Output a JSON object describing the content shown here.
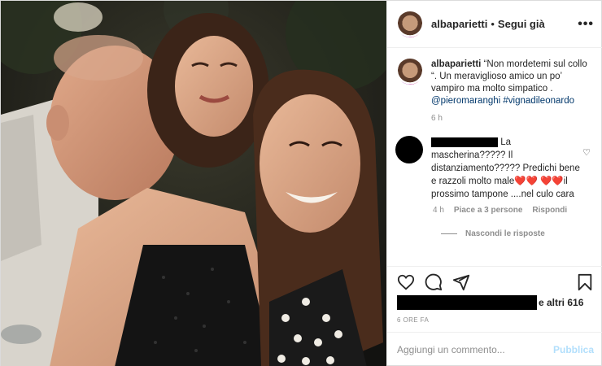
{
  "header": {
    "username": "albaparietti",
    "separator": "•",
    "follow_status": "Segui già",
    "more_icon": "•••"
  },
  "caption": {
    "username": "albaparietti",
    "text": " “Non mordetemi sul collo “. Un meraviglioso amico un po’ vampiro ma molto simpatico . ",
    "mention": "@pieromaranghi",
    "hashtag": "#vignadileonardo",
    "time": "6 h"
  },
  "comment": {
    "text_line1": "La",
    "text_rest": "mascherina????? Il distanziamento????? Predichi bene e razzoli molto male❤️❤️ ❤️❤️il prossimo tampone ....nel culo cara",
    "time": "4 h",
    "likes": "Piace a 3 persone",
    "reply": "Rispondi",
    "hide_replies": "Nascondi le risposte"
  },
  "likes": {
    "suffix": "e altri 616"
  },
  "posted_ago": "6 ORE FA",
  "add_comment": {
    "placeholder": "Aggiungi un commento...",
    "publish": "Pubblica"
  },
  "icons": {
    "heart": "heart-icon",
    "comment": "comment-icon",
    "share": "share-icon",
    "save": "bookmark-icon"
  }
}
